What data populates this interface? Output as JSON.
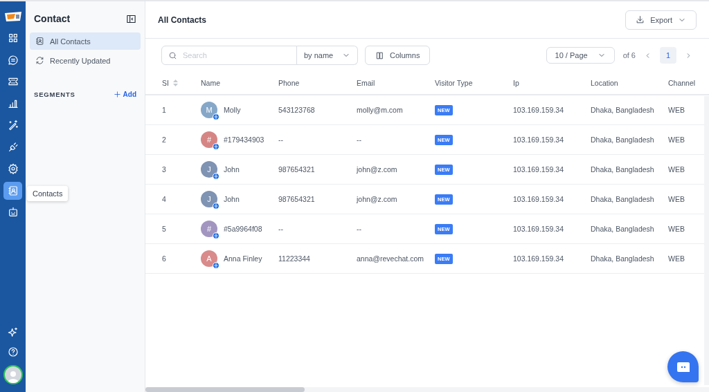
{
  "rail": {
    "items": [
      {
        "selected": false
      },
      {
        "selected": false
      },
      {
        "selected": false
      },
      {
        "selected": false
      },
      {
        "selected": false
      },
      {
        "selected": false
      },
      {
        "selected": false
      },
      {
        "selected": true
      },
      {
        "selected": false
      }
    ],
    "tooltip": "Contacts"
  },
  "sidebar": {
    "title": "Contact",
    "items": [
      {
        "label": "All Contacts",
        "selected": true
      },
      {
        "label": "Recently Updated",
        "selected": false
      }
    ],
    "segments_label": "SEGMENTS",
    "add_label": "Add"
  },
  "main": {
    "title": "All Contacts",
    "export_label": "Export"
  },
  "toolbar": {
    "search_placeholder": "Search",
    "search_by": "by name",
    "columns_label": "Columns",
    "page_size": "10 / Page",
    "page_total": "of 6",
    "pages": [
      {
        "label": "1",
        "selected": true
      }
    ]
  },
  "table": {
    "columns": [
      "SI",
      "Name",
      "Phone",
      "Email",
      "Visitor Type",
      "Ip",
      "Location",
      "Channel"
    ],
    "rows": [
      {
        "si": "1",
        "initial": "M",
        "color": "#86a7c8",
        "name": "Molly",
        "phone": "543123768",
        "email": "molly@m.com",
        "visitor_type": "NEW",
        "ip": "103.169.159.34",
        "location": "Dhaka, Bangladesh",
        "channel": "WEB"
      },
      {
        "si": "2",
        "initial": "#",
        "color": "#d68585",
        "name": "#179434903",
        "phone": "--",
        "email": "--",
        "visitor_type": "NEW",
        "ip": "103.169.159.34",
        "location": "Dhaka, Bangladesh",
        "channel": "WEB"
      },
      {
        "si": "3",
        "initial": "J",
        "color": "#7f93b3",
        "name": "John",
        "phone": "987654321",
        "email": "john@z.com",
        "visitor_type": "NEW",
        "ip": "103.169.159.34",
        "location": "Dhaka, Bangladesh",
        "channel": "WEB"
      },
      {
        "si": "4",
        "initial": "J",
        "color": "#7f93b3",
        "name": "John",
        "phone": "987654321",
        "email": "john@z.com",
        "visitor_type": "NEW",
        "ip": "103.169.159.34",
        "location": "Dhaka, Bangladesh",
        "channel": "WEB"
      },
      {
        "si": "5",
        "initial": "#",
        "color": "#a296c0",
        "name": "#5a9964f08",
        "phone": "--",
        "email": "--",
        "visitor_type": "NEW",
        "ip": "103.169.159.34",
        "location": "Dhaka, Bangladesh",
        "channel": "WEB"
      },
      {
        "si": "6",
        "initial": "A",
        "color": "#d98a8a",
        "name": "Anna Finley",
        "phone": "11223344",
        "email": "anna@revechat.com",
        "visitor_type": "NEW",
        "ip": "103.169.159.34",
        "location": "Dhaka, Bangladesh",
        "channel": "WEB"
      }
    ]
  }
}
